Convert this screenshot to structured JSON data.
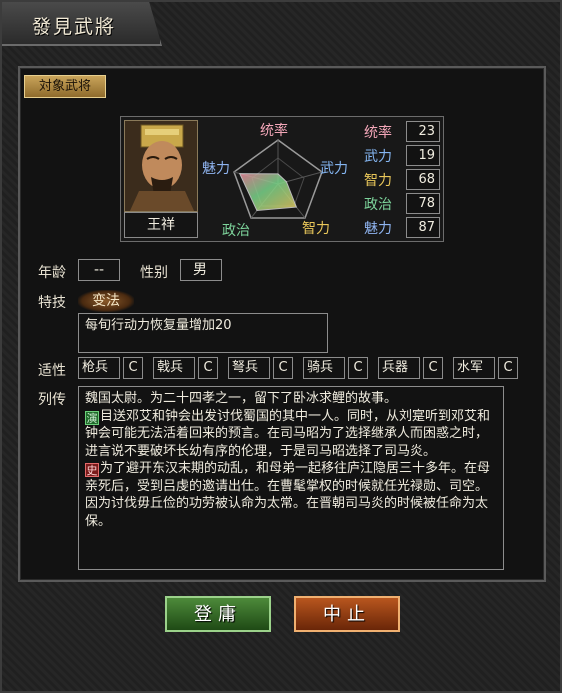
{
  "window": {
    "title": "發見武將"
  },
  "header": {
    "target_label": "対象武将"
  },
  "general": {
    "name": "王祥",
    "radar_labels": {
      "tong": "统率",
      "wu": "武力",
      "zhi": "智力",
      "zheng": "政治",
      "mei": "魅力"
    },
    "stats": [
      {
        "key": "tong",
        "label": "统率",
        "value": "23",
        "color": "#f3a6b8"
      },
      {
        "key": "wu",
        "label": "武力",
        "value": "19",
        "color": "#85b6f2"
      },
      {
        "key": "zhi",
        "label": "智力",
        "value": "68",
        "color": "#e9c75a"
      },
      {
        "key": "zheng",
        "label": "政治",
        "value": "78",
        "color": "#7dd49b"
      },
      {
        "key": "mei",
        "label": "魅力",
        "value": "87",
        "color": "#8fb4f0"
      }
    ]
  },
  "info": {
    "age_label": "年龄",
    "age_value": "--",
    "gender_label": "性别",
    "gender_value": "男",
    "skill_label": "特技",
    "skill_name": "变法",
    "skill_desc": "每旬行动力恢复量增加20"
  },
  "aptitude": {
    "label": "适性",
    "items": [
      {
        "name": "枪兵",
        "grade": "C"
      },
      {
        "name": "戟兵",
        "grade": "C"
      },
      {
        "name": "弩兵",
        "grade": "C"
      },
      {
        "name": "骑兵",
        "grade": "C"
      },
      {
        "name": "兵器",
        "grade": "C"
      },
      {
        "name": "水军",
        "grade": "C"
      }
    ]
  },
  "bio": {
    "label": "列传",
    "intro": "魏国太尉。为二十四孝之一，留下了卧冰求鲤的故事。",
    "tong_icon": "演",
    "tong_text": "目送邓艾和钟会出发讨伐蜀国的其中一人。同时，从刘寔听到邓艾和钟会可能无法活着回来的预言。在司马昭为了选择继承人而困惑之时，进言说不要破坏长幼有序的伦理，于是司马昭选择了司马炎。",
    "shi_icon": "史",
    "shi_text": "为了避开东汉末期的动乱，和母弟一起移往庐江隐居三十多年。在母亲死后，受到吕虔的邀请出仕。在曹髦掌权的时候就任光禄勋、司空。因为讨伐毋丘俭的功劳被认命为太常。在晋朝司马炎的时候被任命为太保。"
  },
  "buttons": {
    "ok": "登庸",
    "cancel": "中止"
  },
  "radar_values": {
    "tong": 23,
    "wu": 19,
    "zhi": 68,
    "zheng": 78,
    "mei": 87
  }
}
